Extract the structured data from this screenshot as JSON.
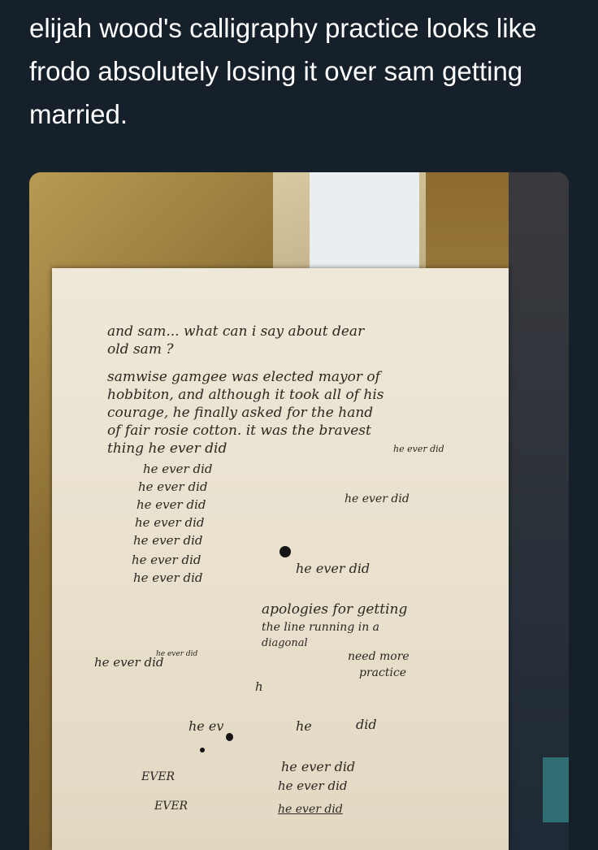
{
  "post": {
    "caption": "elijah wood's calligraphy practice looks like frodo absolutely losing it over sam getting married."
  },
  "handwriting": {
    "paragraph": [
      "and sam... what can i say about dear",
      "old sam ?",
      "samwise gamgee was elected mayor of",
      "hobbiton, and although it took all of his",
      "courage, he finally asked for the hand",
      "of fair rosie cotton. it was the bravest",
      "thing he ever did"
    ],
    "repeat_lines": [
      "he ever did",
      "he ever did",
      "he ever did",
      "he ever did",
      "he ever did",
      "he ever did",
      "he ever did",
      "he ever did",
      "he ever did",
      "he ever did",
      "he ever did"
    ],
    "apology": [
      "apologies for getting",
      "the line running in a",
      "diagonal",
      "need more",
      "practice"
    ],
    "fragments": {
      "h": "h",
      "he_partial": "he ever did",
      "he_ev": "he ev",
      "he": "he",
      "did": "did",
      "ever1": "EVER",
      "ever2": "EVER"
    },
    "bottom_lines": [
      "he ever did",
      "he ever did",
      "he ever did"
    ]
  }
}
